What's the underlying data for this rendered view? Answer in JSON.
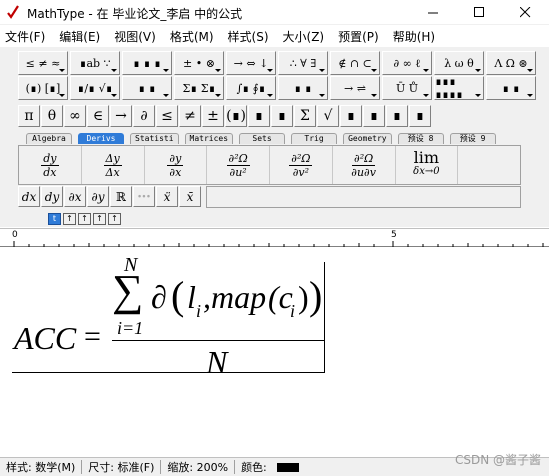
{
  "window": {
    "title": "MathType - 在 毕业论文_李启 中的公式"
  },
  "menu": [
    "文件(F)",
    "编辑(E)",
    "视图(V)",
    "格式(M)",
    "样式(S)",
    "大小(Z)",
    "预置(P)",
    "帮助(H)"
  ],
  "palettes_row1": [
    "≤ ≠ ≈",
    "∎ab ∵",
    "∎ ∎ ∎",
    "± • ⊗",
    "→ ⇔ ↓",
    "∴ ∀ ∃",
    "∉ ∩ ⊂",
    "∂ ∞ ℓ",
    "λ ω θ",
    "Λ Ω ⊛"
  ],
  "palettes_row2": [
    "(∎) [∎]",
    "∎/∎ √∎",
    "∎ ∎",
    "Σ∎ Σ∎",
    "∫∎ ∮∎",
    "∎ ∎",
    "→ ⇌",
    "Ū Ů",
    "∎∎∎ ∎∎∎∎",
    "∎ ∎"
  ],
  "symbols": [
    "π",
    "θ",
    "∞",
    "∈",
    "→",
    "∂",
    "≤",
    "≠",
    "±",
    "(∎)",
    "∎",
    "∎",
    "Σ",
    "√",
    "∎",
    "∎",
    "∎",
    "∎"
  ],
  "tabs": [
    "Algebra",
    "Derivs",
    "Statisti",
    "Matrices",
    "Sets",
    "Trig",
    "Geometry",
    "预设 8",
    "预设 9"
  ],
  "active_tab": "Derivs",
  "templates": [
    {
      "num": "dy",
      "den": "dx"
    },
    {
      "num": "Δy",
      "den": "Δx"
    },
    {
      "num": "∂y",
      "den": "∂x"
    },
    {
      "num": "∂²Ω",
      "den": "∂u²"
    },
    {
      "num": "∂²Ω",
      "den": "∂v²"
    },
    {
      "num": "∂²Ω",
      "den": "∂u∂v"
    },
    {
      "num": "lim",
      "den": "δx→0"
    }
  ],
  "small_templates": [
    "dx",
    "dy",
    "∂x",
    "∂y",
    "ℝ",
    "∙∙∙",
    "ẍ",
    "x̄"
  ],
  "size_buttons": [
    "t",
    "↑",
    "↑",
    "↑",
    "↑"
  ],
  "ruler": {
    "start": "0",
    "mark": "5"
  },
  "equation": {
    "lhs": "ACC",
    "equals": "=",
    "sum_upper": "N",
    "sum_lower": "i=1",
    "sum": "∑",
    "partial": "∂",
    "open": "(",
    "l": "l",
    "l_sub": "i",
    "comma_map": ",map",
    "c": "(c",
    "c_sub": "i",
    "close_inner": ")",
    "close": ")",
    "denominator": "N"
  },
  "status": {
    "style": "样式: 数学(M)",
    "size": "尺寸: 标准(F)",
    "zoom": "缩放: 200%",
    "color_label": "颜色:",
    "color": "#000000"
  },
  "watermark": "CSDN @酱子酱"
}
